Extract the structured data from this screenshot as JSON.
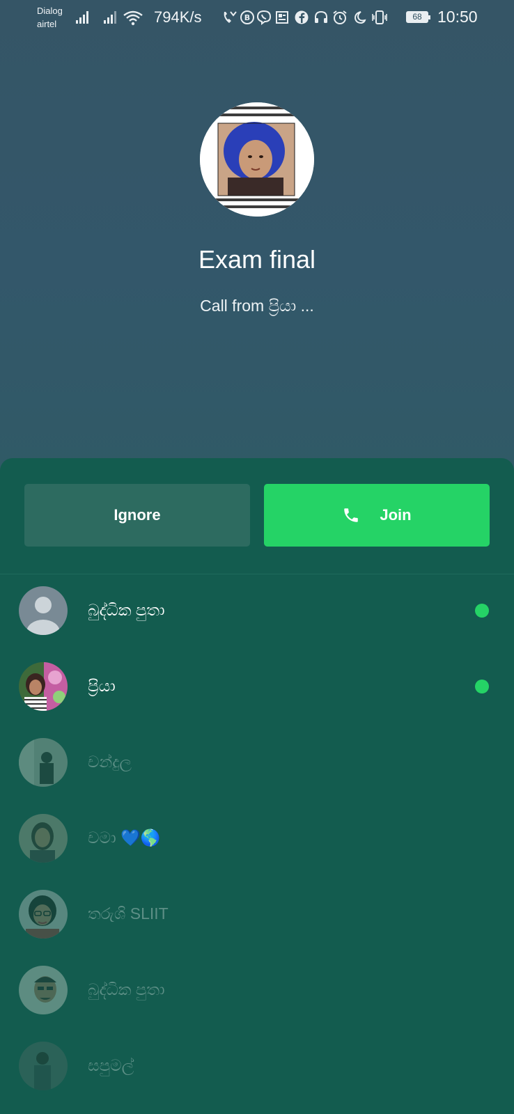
{
  "status_bar": {
    "carrier_1": "Dialog",
    "carrier_2": "airtel",
    "net_speed": "794K/s",
    "battery": "68",
    "time": "10:50",
    "icons": [
      "signal-icon",
      "signal-icon",
      "wifi-icon",
      "missed-call-icon",
      "bbm-icon",
      "viber-icon",
      "news-icon",
      "facebook-icon",
      "headset-icon",
      "alarm-icon",
      "moon-icon",
      "vibrate-icon",
      "battery-icon"
    ]
  },
  "call": {
    "title": "Exam final",
    "subtitle": "Call from ප්‍රියා ..."
  },
  "actions": {
    "ignore_label": "Ignore",
    "join_label": "Join"
  },
  "participants": [
    {
      "name": "බුද්ධික පුතා",
      "online": true
    },
    {
      "name": "ප්‍රියා",
      "online": true
    },
    {
      "name": "චන්දුල",
      "online": false
    },
    {
      "name": "චමා 💙🌎",
      "online": false
    },
    {
      "name": "තරුශි SLIIT",
      "online": false
    },
    {
      "name": "බුද්ධික පුතා",
      "online": false
    },
    {
      "name": "සපුමල්",
      "online": false
    }
  ],
  "colors": {
    "header_bg": "#355566",
    "sheet_bg": "#135c4f",
    "join": "#25d366",
    "ignore": "#2d6b60",
    "online_dot": "#25d366"
  }
}
